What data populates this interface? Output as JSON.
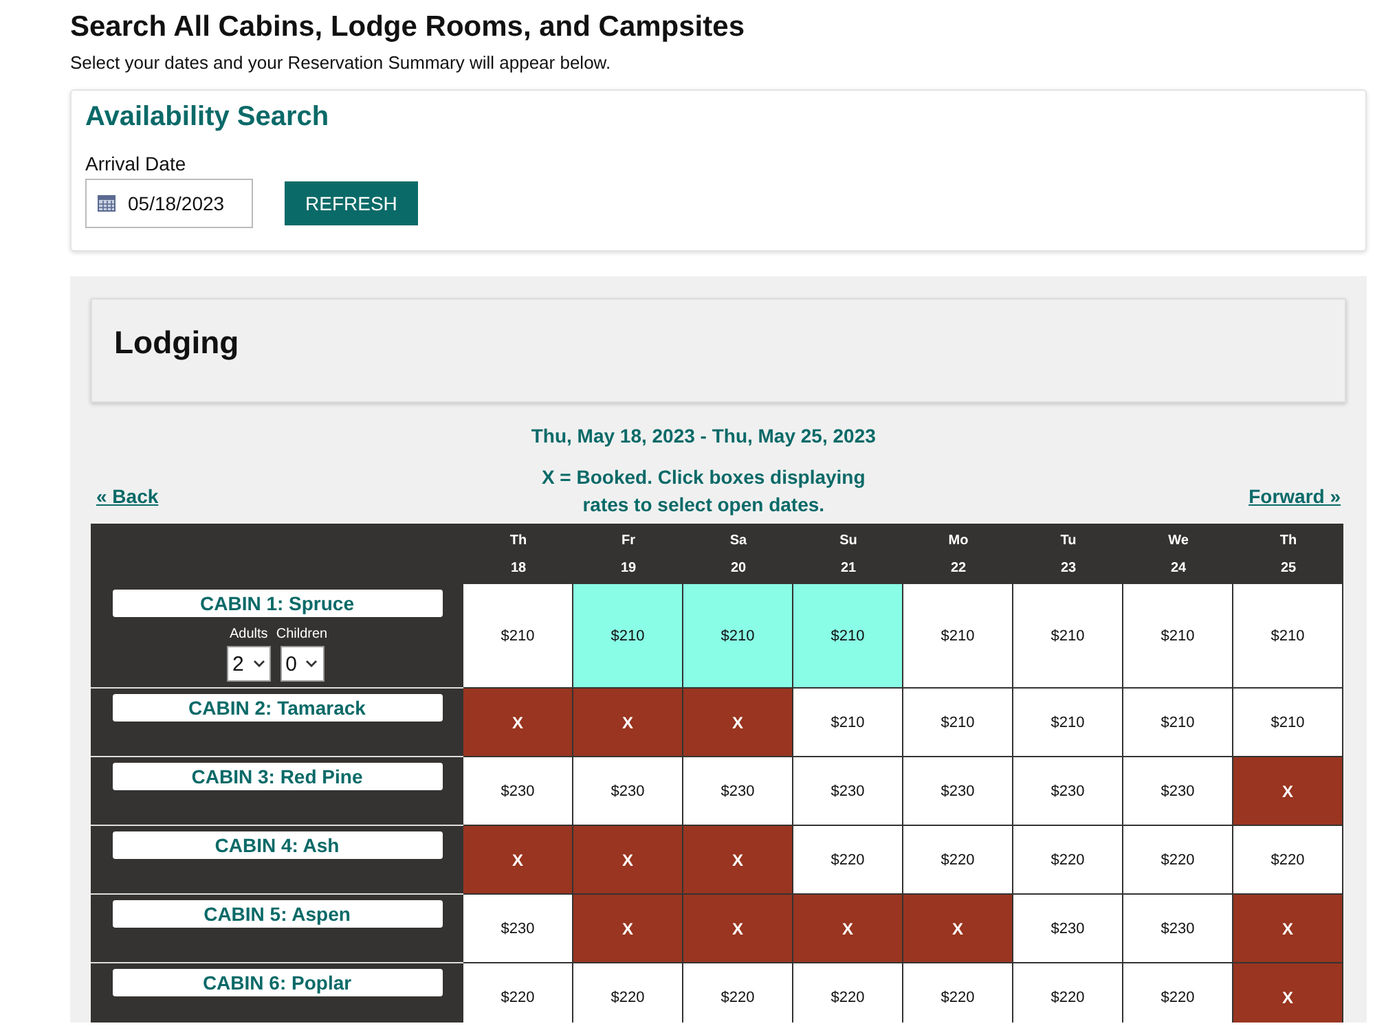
{
  "page": {
    "title": "Search All Cabins, Lodge Rooms, and Campsites",
    "subtitle": "Select your dates and your Reservation Summary will appear below."
  },
  "availability_search": {
    "title": "Availability Search",
    "arrival_date": {
      "label": "Arrival Date",
      "value": "05/18/2023"
    },
    "refresh_button": "REFRESH"
  },
  "lodging": {
    "title": "Lodging",
    "date_range": "Thu, May 18, 2023 - Thu, May 25, 2023",
    "legend": "X = Booked. Click boxes displaying rates to select open dates.",
    "back_link": "« Back",
    "forward_link": "Forward »",
    "days": [
      {
        "weekday": "Th",
        "date": "18"
      },
      {
        "weekday": "Fr",
        "date": "19"
      },
      {
        "weekday": "Sa",
        "date": "20"
      },
      {
        "weekday": "Su",
        "date": "21"
      },
      {
        "weekday": "Mo",
        "date": "22"
      },
      {
        "weekday": "Tu",
        "date": "23"
      },
      {
        "weekday": "We",
        "date": "24"
      },
      {
        "weekday": "Th",
        "date": "25"
      }
    ],
    "units": [
      {
        "name": "CABIN 1: Spruce",
        "guests": {
          "adults_label": "Adults",
          "adults": "2",
          "children_label": "Children",
          "children": "0"
        },
        "cells": [
          {
            "kind": "open",
            "text": "$210",
            "selected": false
          },
          {
            "kind": "open",
            "text": "$210",
            "selected": true
          },
          {
            "kind": "open",
            "text": "$210",
            "selected": true
          },
          {
            "kind": "open",
            "text": "$210",
            "selected": true
          },
          {
            "kind": "open",
            "text": "$210",
            "selected": false
          },
          {
            "kind": "open",
            "text": "$210",
            "selected": false
          },
          {
            "kind": "open",
            "text": "$210",
            "selected": false
          },
          {
            "kind": "open",
            "text": "$210",
            "selected": false
          }
        ]
      },
      {
        "name": "CABIN 2: Tamarack",
        "cells": [
          {
            "kind": "booked",
            "text": "X"
          },
          {
            "kind": "booked",
            "text": "X"
          },
          {
            "kind": "booked",
            "text": "X"
          },
          {
            "kind": "open",
            "text": "$210",
            "selected": false
          },
          {
            "kind": "open",
            "text": "$210",
            "selected": false
          },
          {
            "kind": "open",
            "text": "$210",
            "selected": false
          },
          {
            "kind": "open",
            "text": "$210",
            "selected": false
          },
          {
            "kind": "open",
            "text": "$210",
            "selected": false
          }
        ]
      },
      {
        "name": "CABIN 3: Red Pine",
        "cells": [
          {
            "kind": "open",
            "text": "$230",
            "selected": false
          },
          {
            "kind": "open",
            "text": "$230",
            "selected": false
          },
          {
            "kind": "open",
            "text": "$230",
            "selected": false
          },
          {
            "kind": "open",
            "text": "$230",
            "selected": false
          },
          {
            "kind": "open",
            "text": "$230",
            "selected": false
          },
          {
            "kind": "open",
            "text": "$230",
            "selected": false
          },
          {
            "kind": "open",
            "text": "$230",
            "selected": false
          },
          {
            "kind": "booked",
            "text": "X"
          }
        ]
      },
      {
        "name": "CABIN 4: Ash",
        "cells": [
          {
            "kind": "booked",
            "text": "X"
          },
          {
            "kind": "booked",
            "text": "X"
          },
          {
            "kind": "booked",
            "text": "X"
          },
          {
            "kind": "open",
            "text": "$220",
            "selected": false
          },
          {
            "kind": "open",
            "text": "$220",
            "selected": false
          },
          {
            "kind": "open",
            "text": "$220",
            "selected": false
          },
          {
            "kind": "open",
            "text": "$220",
            "selected": false
          },
          {
            "kind": "open",
            "text": "$220",
            "selected": false
          }
        ]
      },
      {
        "name": "CABIN 5: Aspen",
        "cells": [
          {
            "kind": "open",
            "text": "$230",
            "selected": false
          },
          {
            "kind": "booked",
            "text": "X"
          },
          {
            "kind": "booked",
            "text": "X"
          },
          {
            "kind": "booked",
            "text": "X"
          },
          {
            "kind": "booked",
            "text": "X"
          },
          {
            "kind": "open",
            "text": "$230",
            "selected": false
          },
          {
            "kind": "open",
            "text": "$230",
            "selected": false
          },
          {
            "kind": "booked",
            "text": "X"
          }
        ]
      },
      {
        "name": "CABIN 6: Poplar",
        "cells": [
          {
            "kind": "open",
            "text": "$220",
            "selected": false
          },
          {
            "kind": "open",
            "text": "$220",
            "selected": false
          },
          {
            "kind": "open",
            "text": "$220",
            "selected": false
          },
          {
            "kind": "open",
            "text": "$220",
            "selected": false
          },
          {
            "kind": "open",
            "text": "$220",
            "selected": false
          },
          {
            "kind": "open",
            "text": "$220",
            "selected": false
          },
          {
            "kind": "open",
            "text": "$220",
            "selected": false
          },
          {
            "kind": "booked",
            "text": "X"
          }
        ]
      }
    ]
  }
}
